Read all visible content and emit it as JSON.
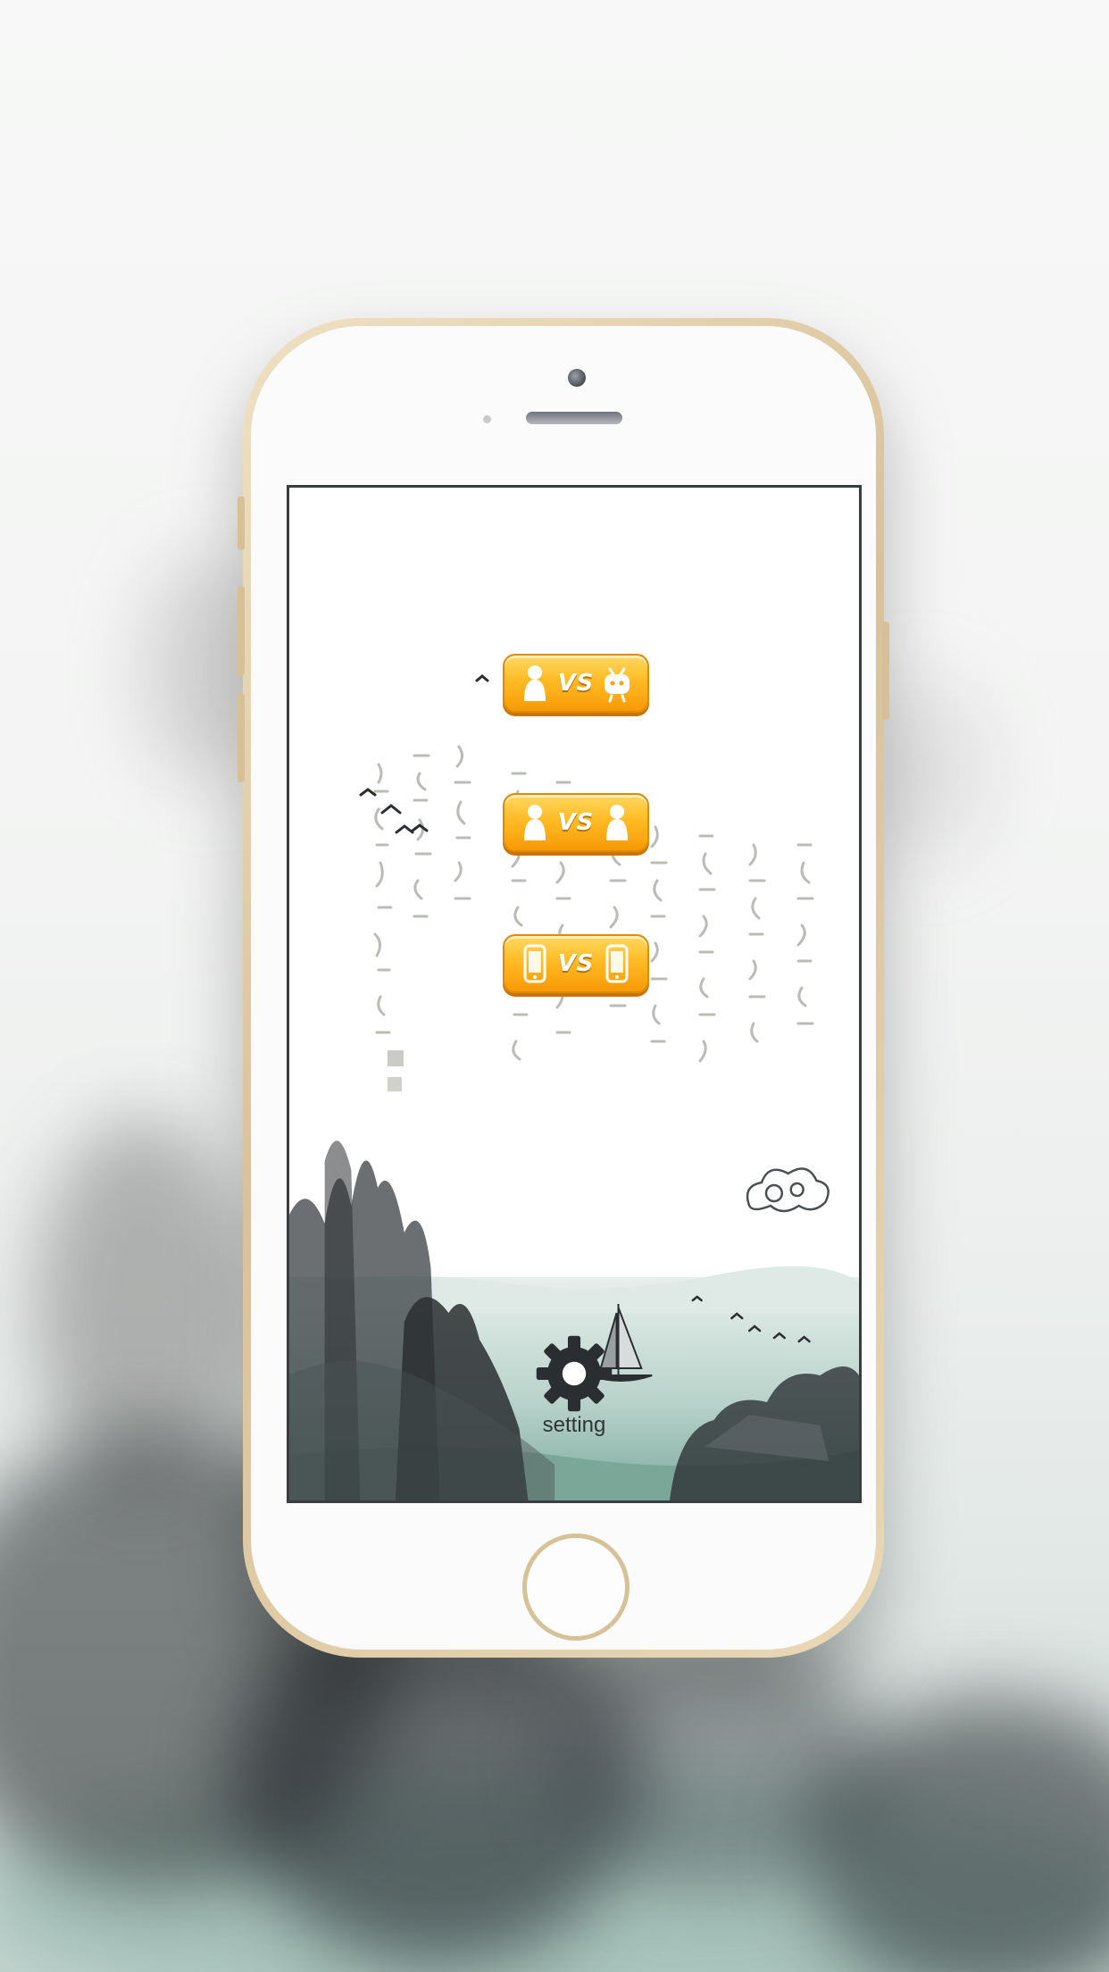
{
  "menu": {
    "buttons": [
      {
        "id": "player-vs-ai",
        "left_icon": "person-icon",
        "vs_label": "VS",
        "right_icon": "robot-icon"
      },
      {
        "id": "player-vs-player",
        "left_icon": "person-icon",
        "vs_label": "VS",
        "right_icon": "person-icon"
      },
      {
        "id": "device-vs-device",
        "left_icon": "phone-icon",
        "vs_label": "VS",
        "right_icon": "phone-icon"
      }
    ]
  },
  "settings": {
    "label": "setting",
    "icon": "gear-icon"
  },
  "colors": {
    "button_top": "#ffd861",
    "button_bottom": "#f79a06",
    "phone_frame": "#d9c29a",
    "ink": "#2a2e31",
    "water": "#8fb9ae"
  }
}
